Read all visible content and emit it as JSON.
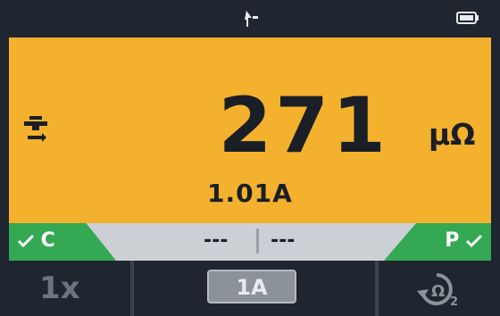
{
  "status_bar": {
    "center_icon": "probe-signal-icon",
    "battery_icon": "battery-icon"
  },
  "main": {
    "mode_icon": "probe-icon",
    "reading": "271",
    "unit": "μΩ",
    "current": "1.01A"
  },
  "indicators": {
    "left_label": "C",
    "left_check_icon": "checkmark-icon",
    "right_label": "P",
    "right_check_icon": "checkmark-icon",
    "aux_left": "---",
    "aux_right": "---"
  },
  "softkeys": {
    "key1": "1x",
    "key2_range": "1A",
    "key3_icon": "reverse-omega-icon",
    "key3_subscript": "2"
  }
}
